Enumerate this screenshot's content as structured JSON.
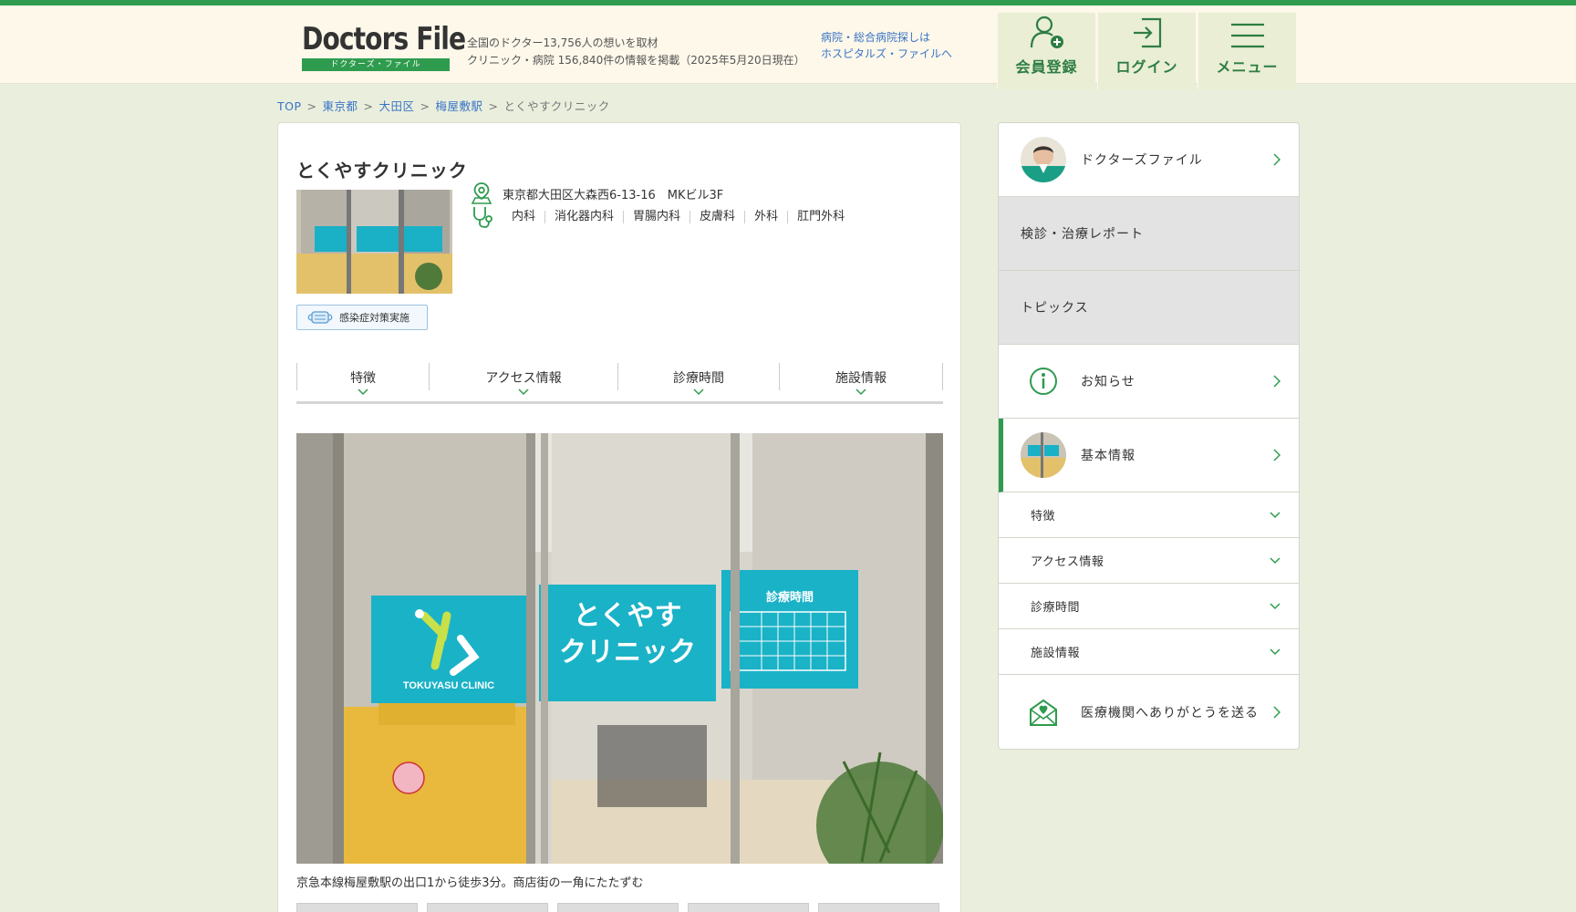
{
  "header": {
    "logo_text": "Doctors File",
    "logo_sub": "ドクターズ・ファイル",
    "tagline_1": "全国のドクター13,756人の想いを取材",
    "tagline_2": "クリニック・病院 156,840件の情報を掲載（2025年5月20日現在）",
    "hospital_link_1": "病院・総合病院探しは",
    "hospital_link_2": "ホスピタルズ・ファイルへ",
    "register_label": "会員登録",
    "login_label": "ログイン",
    "menu_label": "メニュー"
  },
  "breadcrumb": {
    "items": [
      "TOP",
      "東京都",
      "大田区",
      "梅屋敷駅"
    ],
    "current": "とくやすクリニック",
    "separator": ">"
  },
  "clinic": {
    "name": "とくやすクリニック",
    "address": "東京都大田区大森西6-13-16　MKビル3F",
    "departments": [
      "内科",
      "消化器内科",
      "胃腸内科",
      "皮膚科",
      "外科",
      "肛門外科"
    ],
    "badge": "感染症対策実施",
    "tabs": [
      "特徴",
      "アクセス情報",
      "診療時間",
      "施設情報"
    ],
    "photo_caption": "京急本線梅屋敷駅の出口1から徒歩3分。商店街の一角にたたずむ",
    "photo_sign_1": "とくやす",
    "photo_sign_2": "クリニック",
    "photo_sign_logo": "TOKUYASU CLINIC",
    "photo_hours_title": "診療時間"
  },
  "sidebar": {
    "items": [
      {
        "label": "ドクターズファイル"
      },
      {
        "label": "検診・治療レポート"
      },
      {
        "label": "トピックス"
      },
      {
        "label": "お知らせ"
      },
      {
        "label": "基本情報"
      }
    ],
    "sub_items": [
      "特徴",
      "アクセス情報",
      "診療時間",
      "施設情報"
    ],
    "thanks_label": "医療機関へありがとうを送る"
  },
  "colors": {
    "brand_green": "#2e9b4e",
    "link_blue": "#3b74c6",
    "background": "#eaefdd",
    "header_bg": "#fdf8ea"
  }
}
